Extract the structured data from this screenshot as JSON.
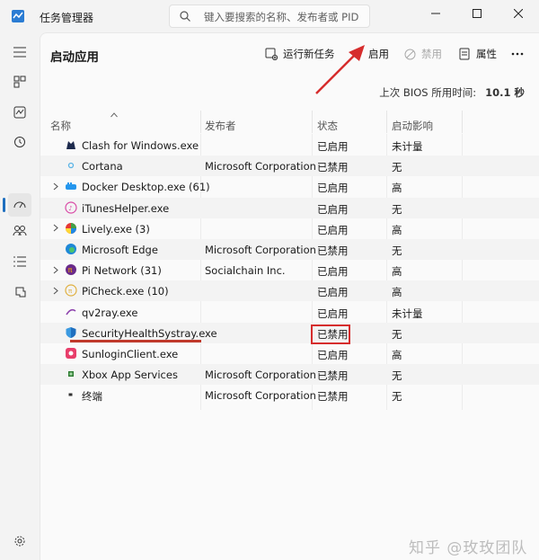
{
  "window": {
    "title": "任务管理器",
    "search_placeholder": "键入要搜索的名称、发布者或 PID"
  },
  "sidebar": {
    "items": [
      {
        "name": "menu-icon"
      },
      {
        "name": "processes-icon"
      },
      {
        "name": "performance-icon"
      },
      {
        "name": "app-history-icon"
      },
      {
        "name": "startup-apps-icon",
        "active": true
      },
      {
        "name": "users-icon"
      },
      {
        "name": "details-icon"
      },
      {
        "name": "services-icon"
      }
    ],
    "settings": "settings-icon"
  },
  "main": {
    "title": "启动应用",
    "toolbar": {
      "run_new_task": "运行新任务",
      "enable": "启用",
      "disable": "禁用",
      "properties": "属性"
    },
    "bios_label": "上次 BIOS 所用时间:",
    "bios_value": "10.1 秒",
    "columns": {
      "name": "名称",
      "publisher": "发布者",
      "status": "状态",
      "impact": "启动影响"
    },
    "rows": [
      {
        "expand": false,
        "icon": "clash-icon",
        "name": "Clash for Windows.exe",
        "publisher": "",
        "status": "已启用",
        "impact": "未计量"
      },
      {
        "expand": false,
        "icon": "cortana-icon",
        "name": "Cortana",
        "publisher": "Microsoft Corporation",
        "status": "已禁用",
        "impact": "无"
      },
      {
        "expand": true,
        "icon": "docker-icon",
        "name": "Docker Desktop.exe (61)",
        "publisher": "",
        "status": "已启用",
        "impact": "高"
      },
      {
        "expand": false,
        "icon": "itunes-icon",
        "name": "iTunesHelper.exe",
        "publisher": "",
        "status": "已启用",
        "impact": "无"
      },
      {
        "expand": true,
        "icon": "lively-icon",
        "name": "Lively.exe (3)",
        "publisher": "",
        "status": "已启用",
        "impact": "高"
      },
      {
        "expand": false,
        "icon": "edge-icon",
        "name": "Microsoft Edge",
        "publisher": "Microsoft Corporation",
        "status": "已禁用",
        "impact": "无"
      },
      {
        "expand": true,
        "icon": "pi-network-icon",
        "name": "Pi Network (31)",
        "publisher": "Socialchain Inc.",
        "status": "已启用",
        "impact": "高"
      },
      {
        "expand": true,
        "icon": "picheck-icon",
        "name": "PiCheck.exe (10)",
        "publisher": "",
        "status": "已启用",
        "impact": "高"
      },
      {
        "expand": false,
        "icon": "qv2ray-icon",
        "name": "qv2ray.exe",
        "publisher": "",
        "status": "已启用",
        "impact": "未计量"
      },
      {
        "expand": false,
        "icon": "security-shield-icon",
        "name": "SecurityHealthSystray.exe",
        "publisher": "",
        "status": "已禁用",
        "impact": "无"
      },
      {
        "expand": false,
        "icon": "sunlogin-icon",
        "name": "SunloginClient.exe",
        "publisher": "",
        "status": "已启用",
        "impact": "高"
      },
      {
        "expand": false,
        "icon": "xbox-icon",
        "name": "Xbox App Services",
        "publisher": "Microsoft Corporation",
        "status": "已禁用",
        "impact": "无"
      },
      {
        "expand": false,
        "icon": "terminal-icon",
        "name": "终端",
        "publisher": "Microsoft Corporation",
        "status": "已禁用",
        "impact": "无"
      }
    ]
  },
  "watermark": "知乎 @玫玫团队",
  "colors": {
    "accent": "#1f6fbf",
    "annotation_red": "#d62d2d"
  }
}
